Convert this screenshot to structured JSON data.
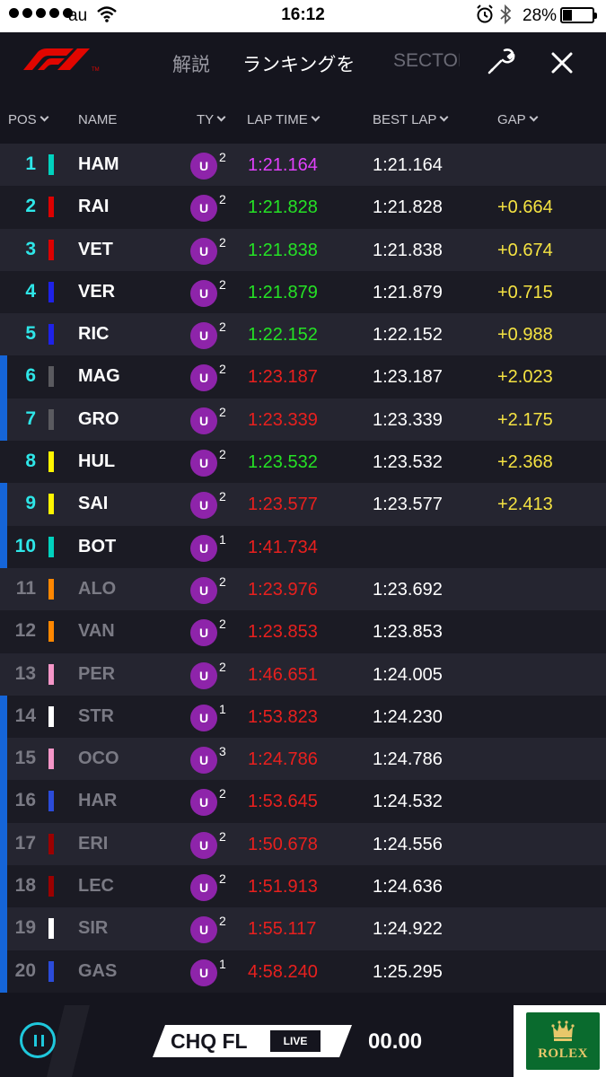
{
  "status_bar": {
    "carrier": "au",
    "time": "16:12",
    "battery": "28%",
    "battery_level": 0.28
  },
  "header": {
    "tabs": [
      {
        "label": "解説"
      },
      {
        "label": "ランキングを"
      },
      {
        "label": "SECTOR"
      }
    ],
    "icons": [
      "f1-logo",
      "wrench-icon",
      "close-icon"
    ]
  },
  "columns": {
    "pos": "POS",
    "name": "NAME",
    "tyre": "TY",
    "lap_time": "LAP TIME",
    "best_lap": "BEST LAP",
    "gap": "GAP"
  },
  "colors": {
    "purple": "#e040fb",
    "green": "#25e225",
    "red": "#e8201e",
    "yellow": "#f5e342",
    "active_pos": "#2ee6e8",
    "out_pos": "#7a7a84",
    "edge": "#1565d8"
  },
  "rows": [
    {
      "pos": "1",
      "name": "HAM",
      "team_color": "#00d2be",
      "tyre": "U",
      "tyre_age": "2",
      "lap": "1:21.164",
      "lap_color": "#e040fb",
      "best": "1:21.164",
      "gap": "",
      "active": true,
      "edge": false
    },
    {
      "pos": "2",
      "name": "RAI",
      "team_color": "#dc0000",
      "tyre": "U",
      "tyre_age": "2",
      "lap": "1:21.828",
      "lap_color": "#25e225",
      "best": "1:21.828",
      "gap": "+0.664",
      "active": true,
      "edge": false
    },
    {
      "pos": "3",
      "name": "VET",
      "team_color": "#dc0000",
      "tyre": "U",
      "tyre_age": "2",
      "lap": "1:21.838",
      "lap_color": "#25e225",
      "best": "1:21.838",
      "gap": "+0.674",
      "active": true,
      "edge": false
    },
    {
      "pos": "4",
      "name": "VER",
      "team_color": "#1e22e8",
      "tyre": "U",
      "tyre_age": "2",
      "lap": "1:21.879",
      "lap_color": "#25e225",
      "best": "1:21.879",
      "gap": "+0.715",
      "active": true,
      "edge": false
    },
    {
      "pos": "5",
      "name": "RIC",
      "team_color": "#1e22e8",
      "tyre": "U",
      "tyre_age": "2",
      "lap": "1:22.152",
      "lap_color": "#25e225",
      "best": "1:22.152",
      "gap": "+0.988",
      "active": true,
      "edge": false
    },
    {
      "pos": "6",
      "name": "MAG",
      "team_color": "#5a5a5f",
      "tyre": "U",
      "tyre_age": "2",
      "lap": "1:23.187",
      "lap_color": "#e8201e",
      "best": "1:23.187",
      "gap": "+2.023",
      "active": true,
      "edge": true
    },
    {
      "pos": "7",
      "name": "GRO",
      "team_color": "#5a5a5f",
      "tyre": "U",
      "tyre_age": "2",
      "lap": "1:23.339",
      "lap_color": "#e8201e",
      "best": "1:23.339",
      "gap": "+2.175",
      "active": true,
      "edge": true
    },
    {
      "pos": "8",
      "name": "HUL",
      "team_color": "#fff500",
      "tyre": "U",
      "tyre_age": "2",
      "lap": "1:23.532",
      "lap_color": "#25e225",
      "best": "1:23.532",
      "gap": "+2.368",
      "active": true,
      "edge": false
    },
    {
      "pos": "9",
      "name": "SAI",
      "team_color": "#fff500",
      "tyre": "U",
      "tyre_age": "2",
      "lap": "1:23.577",
      "lap_color": "#e8201e",
      "best": "1:23.577",
      "gap": "+2.413",
      "active": true,
      "edge": true
    },
    {
      "pos": "10",
      "name": "BOT",
      "team_color": "#00d2be",
      "tyre": "U",
      "tyre_age": "1",
      "lap": "1:41.734",
      "lap_color": "#e8201e",
      "best": "",
      "gap": "",
      "active": true,
      "edge": true
    },
    {
      "pos": "11",
      "name": "ALO",
      "team_color": "#ff8700",
      "tyre": "U",
      "tyre_age": "2",
      "lap": "1:23.976",
      "lap_color": "#e8201e",
      "best": "1:23.692",
      "gap": "",
      "active": false,
      "edge": false
    },
    {
      "pos": "12",
      "name": "VAN",
      "team_color": "#ff8700",
      "tyre": "U",
      "tyre_age": "2",
      "lap": "1:23.853",
      "lap_color": "#e8201e",
      "best": "1:23.853",
      "gap": "",
      "active": false,
      "edge": false
    },
    {
      "pos": "13",
      "name": "PER",
      "team_color": "#f596c8",
      "tyre": "U",
      "tyre_age": "2",
      "lap": "1:46.651",
      "lap_color": "#e8201e",
      "best": "1:24.005",
      "gap": "",
      "active": false,
      "edge": false
    },
    {
      "pos": "14",
      "name": "STR",
      "team_color": "#ffffff",
      "tyre": "U",
      "tyre_age": "1",
      "lap": "1:53.823",
      "lap_color": "#e8201e",
      "best": "1:24.230",
      "gap": "",
      "active": false,
      "edge": true
    },
    {
      "pos": "15",
      "name": "OCO",
      "team_color": "#f596c8",
      "tyre": "U",
      "tyre_age": "3",
      "lap": "1:24.786",
      "lap_color": "#e8201e",
      "best": "1:24.786",
      "gap": "",
      "active": false,
      "edge": true
    },
    {
      "pos": "16",
      "name": "HAR",
      "team_color": "#2b4bd9",
      "tyre": "U",
      "tyre_age": "2",
      "lap": "1:53.645",
      "lap_color": "#e8201e",
      "best": "1:24.532",
      "gap": "",
      "active": false,
      "edge": true
    },
    {
      "pos": "17",
      "name": "ERI",
      "team_color": "#9b0000",
      "tyre": "U",
      "tyre_age": "2",
      "lap": "1:50.678",
      "lap_color": "#e8201e",
      "best": "1:24.556",
      "gap": "",
      "active": false,
      "edge": true
    },
    {
      "pos": "18",
      "name": "LEC",
      "team_color": "#9b0000",
      "tyre": "U",
      "tyre_age": "2",
      "lap": "1:51.913",
      "lap_color": "#e8201e",
      "best": "1:24.636",
      "gap": "",
      "active": false,
      "edge": true
    },
    {
      "pos": "19",
      "name": "SIR",
      "team_color": "#ffffff",
      "tyre": "U",
      "tyre_age": "2",
      "lap": "1:55.117",
      "lap_color": "#e8201e",
      "best": "1:24.922",
      "gap": "",
      "active": false,
      "edge": true
    },
    {
      "pos": "20",
      "name": "GAS",
      "team_color": "#2b4bd9",
      "tyre": "U",
      "tyre_age": "1",
      "lap": "4:58.240",
      "lap_color": "#e8201e",
      "best": "1:25.295",
      "gap": "",
      "active": false,
      "edge": true
    }
  ],
  "footer": {
    "session": "CHQ FL",
    "live": "LIVE",
    "timer": "00.00",
    "sponsor": "ROLEX"
  }
}
